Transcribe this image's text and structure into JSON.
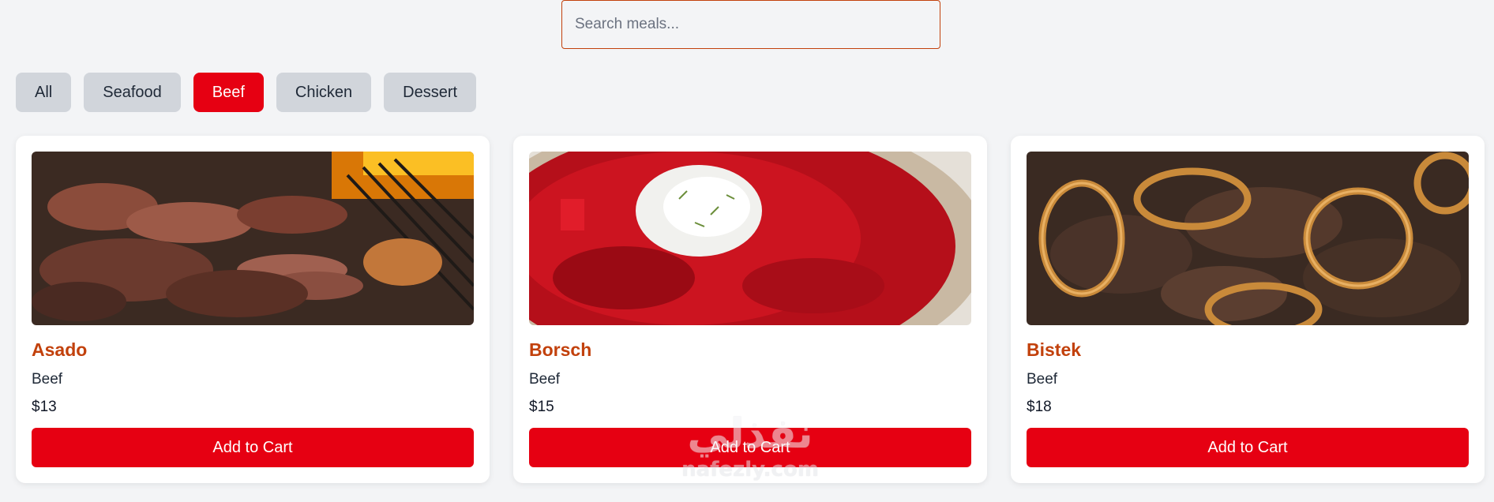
{
  "search": {
    "placeholder": "Search meals..."
  },
  "filters": [
    {
      "label": "All",
      "active": false
    },
    {
      "label": "Seafood",
      "active": false
    },
    {
      "label": "Beef",
      "active": true
    },
    {
      "label": "Chicken",
      "active": false
    },
    {
      "label": "Dessert",
      "active": false
    }
  ],
  "meals": [
    {
      "name": "Asado",
      "category": "Beef",
      "price": "$13",
      "button": "Add to Cart"
    },
    {
      "name": "Borsch",
      "category": "Beef",
      "price": "$15",
      "button": "Add to Cart"
    },
    {
      "name": "Bistek",
      "category": "Beef",
      "price": "$18",
      "button": "Add to Cart"
    }
  ],
  "watermark": {
    "arabic": "نفذلي",
    "latin": "nafezly.com"
  },
  "colors": {
    "accent": "#e60012",
    "title": "#c2410c",
    "background": "#f3f4f6"
  }
}
